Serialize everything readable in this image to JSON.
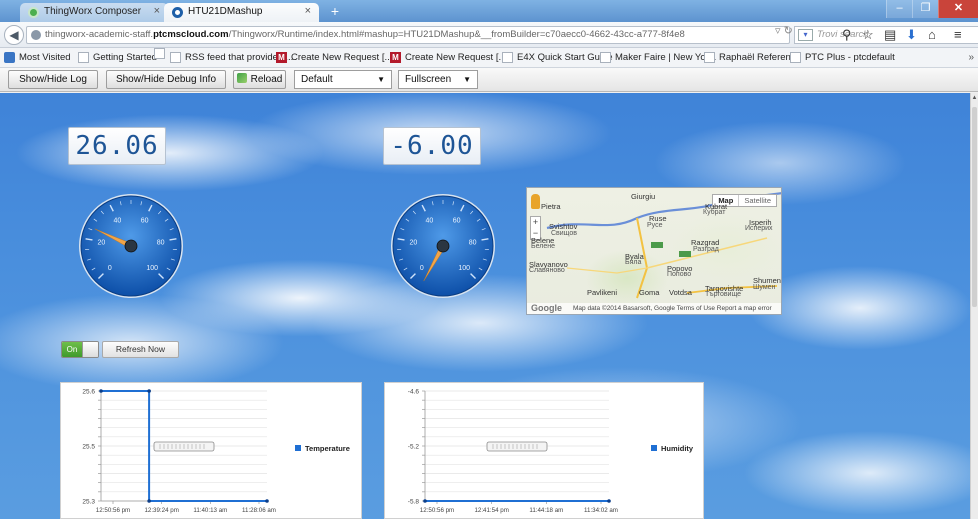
{
  "browser": {
    "tabs": [
      {
        "title": "ThingWorx Composer",
        "active": false
      },
      {
        "title": "HTU21DMashup",
        "active": true
      }
    ],
    "close_glyph": "×",
    "new_tab_glyph": "+",
    "url": {
      "prefix": "thingworx-academic-staff.",
      "domain": "ptcmscloud.com",
      "suffix": "/Thingworx/Runtime/index.html#mashup=HTU21DMashup&__fromBuilder=c70aecc0-4662-43cc-a777-8f4e8"
    },
    "search_placeholder": "Trovi search",
    "bookmarks": [
      "Most Visited",
      "Getting Started",
      "",
      "RSS feed that provides ...",
      "Create New Request [...",
      "Create New Request [...",
      "E4X Quick Start Guide",
      "Maker Faire | New Yor...",
      "Raphaël Reference",
      "PTC Plus - ptcdefault"
    ],
    "bookmark_more": "»",
    "icons": [
      "back-arrow-icon",
      "lock-icon",
      "reload-icon",
      "search-icon",
      "star-icon",
      "bookmarks-list-icon",
      "download-icon",
      "home-icon",
      "menu-icon"
    ]
  },
  "toolbar": {
    "show_hide_log": "Show/Hide Log",
    "show_hide_debug": "Show/Hide Debug Info",
    "reload": "Reload",
    "theme_select": "Default",
    "mode_select": "Fullscreen"
  },
  "mashup": {
    "temperature_display": "26.06",
    "humidity_display": "-6.00",
    "temperature_gauge": {
      "value": 26.06,
      "min": 0,
      "max": 100,
      "ticks": [
        "0",
        "20",
        "40",
        "60",
        "80",
        "100"
      ]
    },
    "humidity_gauge": {
      "value": -6.0,
      "min": 0,
      "max": 100,
      "ticks": [
        "0",
        "20",
        "40",
        "60",
        "80",
        "100"
      ]
    },
    "toggle_label": "On",
    "refresh_button": "Refresh Now",
    "map": {
      "type_map": "Map",
      "type_satellite": "Satellite",
      "labels": [
        "Giurgiu",
        "Pietra",
        "Ruse",
        "Русе",
        "Svishtov",
        "Свищов",
        "Byala",
        "Бяла",
        "Popovo",
        "Попово",
        "Razgrad",
        "Разград",
        "Slavyanovo",
        "Славяново",
        "Pavlikeni",
        "Goma",
        "Targovishte",
        "Търговище",
        "Shumen",
        "Шумен",
        "Kubrat",
        "Кубрат",
        "Isperih",
        "Исперих",
        "Belene",
        "Белене",
        "Votdsa"
      ],
      "attribution": "Map data ©2014 Basarsoft, Google   Terms of Use   Report a map error",
      "logo": "Google"
    }
  },
  "chart_data": [
    {
      "type": "line",
      "title": "",
      "x_tick_labels": [
        "12:50:56 pm",
        "12:39:24 pm",
        "11:40:13 am",
        "11:28:06 am"
      ],
      "y_tick_labels": [
        "25.6",
        "25.5",
        "25.3"
      ],
      "ylim": [
        25.3,
        25.6
      ],
      "series": [
        {
          "name": "Temperature",
          "color": "#1f6fd3",
          "points": [
            {
              "x": 0,
              "y": 25.6
            },
            {
              "x": 0.29,
              "y": 25.6
            },
            {
              "x": 0.29,
              "y": 25.3
            },
            {
              "x": 1.0,
              "y": 25.3
            }
          ]
        }
      ],
      "legend_position": "right",
      "grid": true
    },
    {
      "type": "line",
      "title": "",
      "x_tick_labels": [
        "12:50:56 pm",
        "12:41:54 pm",
        "11:44:18 am",
        "11:34:02 am"
      ],
      "y_tick_labels": [
        "-4.6",
        "-5.2",
        "-5.8"
      ],
      "ylim": [
        -5.8,
        -4.6
      ],
      "series": [
        {
          "name": "Humidity",
          "color": "#1f6fd3",
          "points": [
            {
              "x": 0,
              "y": -5.8
            },
            {
              "x": 1.0,
              "y": -5.8
            }
          ]
        }
      ],
      "legend_position": "right",
      "grid": true
    }
  ]
}
